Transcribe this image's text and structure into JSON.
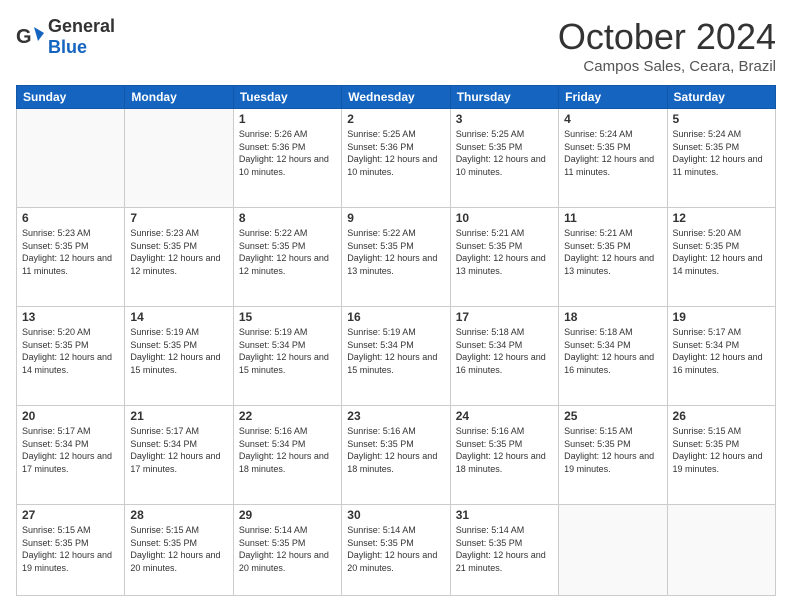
{
  "header": {
    "logo": {
      "text_general": "General",
      "text_blue": "Blue"
    },
    "title": "October 2024",
    "location": "Campos Sales, Ceara, Brazil"
  },
  "calendar": {
    "days_of_week": [
      "Sunday",
      "Monday",
      "Tuesday",
      "Wednesday",
      "Thursday",
      "Friday",
      "Saturday"
    ],
    "weeks": [
      [
        {
          "day": "",
          "info": ""
        },
        {
          "day": "",
          "info": ""
        },
        {
          "day": "1",
          "info": "Sunrise: 5:26 AM\nSunset: 5:36 PM\nDaylight: 12 hours and 10 minutes."
        },
        {
          "day": "2",
          "info": "Sunrise: 5:25 AM\nSunset: 5:36 PM\nDaylight: 12 hours and 10 minutes."
        },
        {
          "day": "3",
          "info": "Sunrise: 5:25 AM\nSunset: 5:35 PM\nDaylight: 12 hours and 10 minutes."
        },
        {
          "day": "4",
          "info": "Sunrise: 5:24 AM\nSunset: 5:35 PM\nDaylight: 12 hours and 11 minutes."
        },
        {
          "day": "5",
          "info": "Sunrise: 5:24 AM\nSunset: 5:35 PM\nDaylight: 12 hours and 11 minutes."
        }
      ],
      [
        {
          "day": "6",
          "info": "Sunrise: 5:23 AM\nSunset: 5:35 PM\nDaylight: 12 hours and 11 minutes."
        },
        {
          "day": "7",
          "info": "Sunrise: 5:23 AM\nSunset: 5:35 PM\nDaylight: 12 hours and 12 minutes."
        },
        {
          "day": "8",
          "info": "Sunrise: 5:22 AM\nSunset: 5:35 PM\nDaylight: 12 hours and 12 minutes."
        },
        {
          "day": "9",
          "info": "Sunrise: 5:22 AM\nSunset: 5:35 PM\nDaylight: 12 hours and 13 minutes."
        },
        {
          "day": "10",
          "info": "Sunrise: 5:21 AM\nSunset: 5:35 PM\nDaylight: 12 hours and 13 minutes."
        },
        {
          "day": "11",
          "info": "Sunrise: 5:21 AM\nSunset: 5:35 PM\nDaylight: 12 hours and 13 minutes."
        },
        {
          "day": "12",
          "info": "Sunrise: 5:20 AM\nSunset: 5:35 PM\nDaylight: 12 hours and 14 minutes."
        }
      ],
      [
        {
          "day": "13",
          "info": "Sunrise: 5:20 AM\nSunset: 5:35 PM\nDaylight: 12 hours and 14 minutes."
        },
        {
          "day": "14",
          "info": "Sunrise: 5:19 AM\nSunset: 5:35 PM\nDaylight: 12 hours and 15 minutes."
        },
        {
          "day": "15",
          "info": "Sunrise: 5:19 AM\nSunset: 5:34 PM\nDaylight: 12 hours and 15 minutes."
        },
        {
          "day": "16",
          "info": "Sunrise: 5:19 AM\nSunset: 5:34 PM\nDaylight: 12 hours and 15 minutes."
        },
        {
          "day": "17",
          "info": "Sunrise: 5:18 AM\nSunset: 5:34 PM\nDaylight: 12 hours and 16 minutes."
        },
        {
          "day": "18",
          "info": "Sunrise: 5:18 AM\nSunset: 5:34 PM\nDaylight: 12 hours and 16 minutes."
        },
        {
          "day": "19",
          "info": "Sunrise: 5:17 AM\nSunset: 5:34 PM\nDaylight: 12 hours and 16 minutes."
        }
      ],
      [
        {
          "day": "20",
          "info": "Sunrise: 5:17 AM\nSunset: 5:34 PM\nDaylight: 12 hours and 17 minutes."
        },
        {
          "day": "21",
          "info": "Sunrise: 5:17 AM\nSunset: 5:34 PM\nDaylight: 12 hours and 17 minutes."
        },
        {
          "day": "22",
          "info": "Sunrise: 5:16 AM\nSunset: 5:34 PM\nDaylight: 12 hours and 18 minutes."
        },
        {
          "day": "23",
          "info": "Sunrise: 5:16 AM\nSunset: 5:35 PM\nDaylight: 12 hours and 18 minutes."
        },
        {
          "day": "24",
          "info": "Sunrise: 5:16 AM\nSunset: 5:35 PM\nDaylight: 12 hours and 18 minutes."
        },
        {
          "day": "25",
          "info": "Sunrise: 5:15 AM\nSunset: 5:35 PM\nDaylight: 12 hours and 19 minutes."
        },
        {
          "day": "26",
          "info": "Sunrise: 5:15 AM\nSunset: 5:35 PM\nDaylight: 12 hours and 19 minutes."
        }
      ],
      [
        {
          "day": "27",
          "info": "Sunrise: 5:15 AM\nSunset: 5:35 PM\nDaylight: 12 hours and 19 minutes."
        },
        {
          "day": "28",
          "info": "Sunrise: 5:15 AM\nSunset: 5:35 PM\nDaylight: 12 hours and 20 minutes."
        },
        {
          "day": "29",
          "info": "Sunrise: 5:14 AM\nSunset: 5:35 PM\nDaylight: 12 hours and 20 minutes."
        },
        {
          "day": "30",
          "info": "Sunrise: 5:14 AM\nSunset: 5:35 PM\nDaylight: 12 hours and 20 minutes."
        },
        {
          "day": "31",
          "info": "Sunrise: 5:14 AM\nSunset: 5:35 PM\nDaylight: 12 hours and 21 minutes."
        },
        {
          "day": "",
          "info": ""
        },
        {
          "day": "",
          "info": ""
        }
      ]
    ]
  }
}
